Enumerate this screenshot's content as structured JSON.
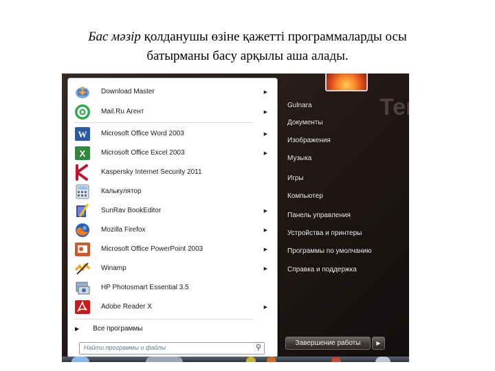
{
  "caption": {
    "emphasis": "Бас мәзір",
    "line1_rest": " қолданушы өзіне қажетті программаларды осы",
    "line2": "батырманы басу арқылы аша алады."
  },
  "desktop": {
    "background_text": "Текст сл"
  },
  "start_menu": {
    "programs": [
      {
        "label": "Download Master",
        "icon": "download-master-icon",
        "arrow": true
      },
      {
        "label": "Mail.Ru Агент",
        "icon": "mail-ru-agent-icon",
        "arrow": true
      },
      {
        "label": "Microsoft Office Word 2003",
        "icon": "word-icon",
        "arrow": true
      },
      {
        "label": "Microsoft Office Excel 2003",
        "icon": "excel-icon",
        "arrow": true
      },
      {
        "label": "Kaspersky Internet Security 2011",
        "icon": "kaspersky-icon",
        "arrow": false
      },
      {
        "label": "Калькулятор",
        "icon": "calculator-icon",
        "arrow": false
      },
      {
        "label": "SunRav BookEditor",
        "icon": "sunrav-icon",
        "arrow": true
      },
      {
        "label": "Mozilla Firefox",
        "icon": "firefox-icon",
        "arrow": true
      },
      {
        "label": "Microsoft Office PowerPoint 2003",
        "icon": "powerpoint-icon",
        "arrow": true
      },
      {
        "label": "Winamp",
        "icon": "winamp-icon",
        "arrow": true
      },
      {
        "label": "HP Photosmart Essential 3.5",
        "icon": "hp-photosmart-icon",
        "arrow": false
      },
      {
        "label": "Adobe Reader X",
        "icon": "adobe-reader-icon",
        "arrow": true
      }
    ],
    "all_programs": "Все программы",
    "search_placeholder": "Найти программы и файлы",
    "right_items": [
      "Gulnara",
      "Документы",
      "Изображения",
      "Музыка",
      "Игры",
      "Компьютер",
      "Панель управления",
      "Устройства и принтеры",
      "Программы по умолчанию",
      "Справка и поддержка"
    ],
    "shutdown_label": "Завершение работы"
  },
  "colors": {
    "menu_bg": "#ffffff",
    "desktop_dark": "#241a17",
    "right_text": "#f2f2f2",
    "search_border": "#8f9bab"
  }
}
